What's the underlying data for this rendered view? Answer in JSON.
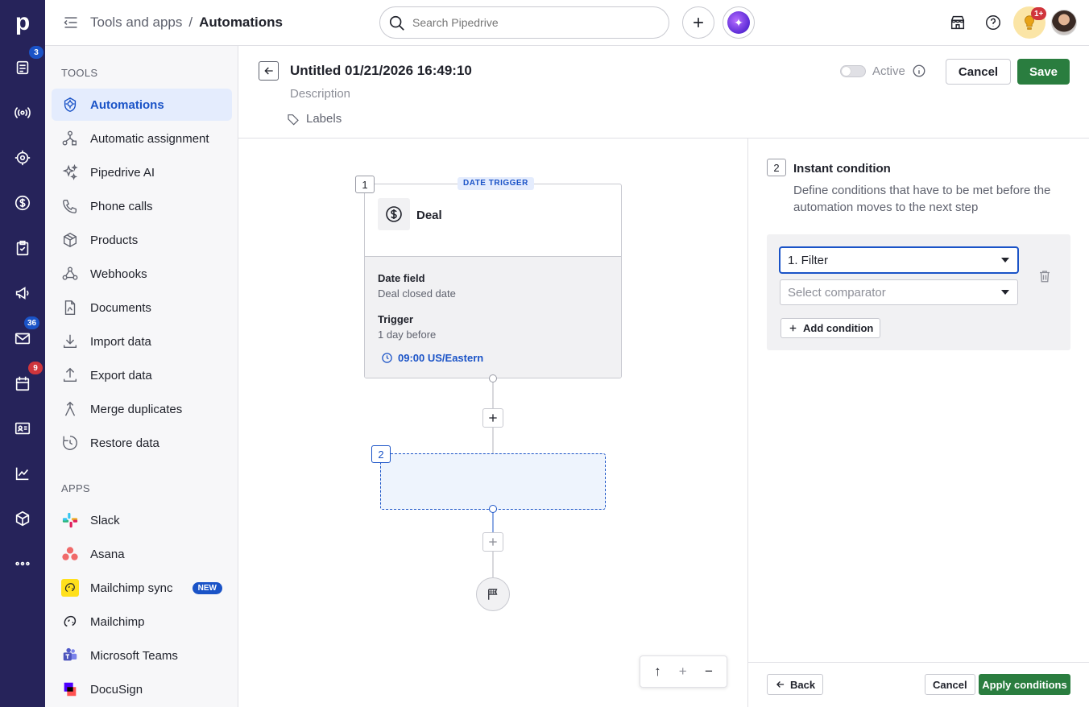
{
  "rail": {
    "badges": {
      "leads": "3",
      "mail": "36",
      "activities": "9"
    }
  },
  "topbar": {
    "breadcrumb_parent": "Tools and apps",
    "breadcrumb_sep": "/",
    "breadcrumb_current": "Automations",
    "search_placeholder": "Search Pipedrive",
    "notif_badge": "1+"
  },
  "sidebar": {
    "tools_title": "TOOLS",
    "tools": [
      {
        "label": "Automations",
        "icon": "automations-icon",
        "active": true
      },
      {
        "label": "Automatic assignment",
        "icon": "assignment-icon"
      },
      {
        "label": "Pipedrive AI",
        "icon": "sparkle-icon"
      },
      {
        "label": "Phone calls",
        "icon": "phone-icon"
      },
      {
        "label": "Products",
        "icon": "box-icon"
      },
      {
        "label": "Webhooks",
        "icon": "webhook-icon"
      },
      {
        "label": "Documents",
        "icon": "document-icon"
      },
      {
        "label": "Import data",
        "icon": "import-icon"
      },
      {
        "label": "Export data",
        "icon": "export-icon"
      },
      {
        "label": "Merge duplicates",
        "icon": "merge-icon"
      },
      {
        "label": "Restore data",
        "icon": "restore-icon"
      }
    ],
    "apps_title": "APPS",
    "apps": [
      {
        "label": "Slack",
        "icon": "slack-logo-icon"
      },
      {
        "label": "Asana",
        "icon": "asana-logo-icon"
      },
      {
        "label": "Mailchimp sync",
        "icon": "mailchimp-logo-icon",
        "badge": "NEW"
      },
      {
        "label": "Mailchimp",
        "icon": "mailchimp-logo-icon"
      },
      {
        "label": "Microsoft Teams",
        "icon": "teams-logo-icon"
      },
      {
        "label": "DocuSign",
        "icon": "docusign-logo-icon"
      }
    ]
  },
  "header": {
    "title": "Untitled 01/21/2026 16:49:10",
    "description_placeholder": "Description",
    "labels": "Labels",
    "active_label": "Active",
    "cancel": "Cancel",
    "save": "Save"
  },
  "canvas": {
    "node1": {
      "num": "1",
      "tag": "DATE TRIGGER",
      "entity": "Deal",
      "date_field_label": "Date field",
      "date_field_value": "Deal closed date",
      "trigger_label": "Trigger",
      "trigger_value": "1 day before",
      "time": "09:00 US/Eastern"
    },
    "node2": {
      "num": "2"
    },
    "zoom": {
      "up": "↑",
      "plus": "+",
      "minus": "−"
    }
  },
  "panel": {
    "step_num": "2",
    "title": "Instant condition",
    "description": "Define conditions that have to be met before the automation moves to the next step",
    "filter_value": "1. Filter",
    "comparator_placeholder": "Select comparator",
    "add_condition": "Add condition",
    "back": "Back",
    "cancel": "Cancel",
    "apply": "Apply conditions"
  },
  "colors": {
    "rail": "#26235a",
    "accent": "#1a53c7",
    "save": "#2a7d3f"
  }
}
